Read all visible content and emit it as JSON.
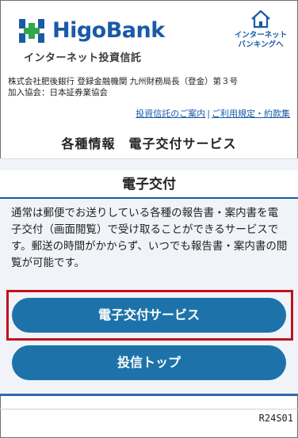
{
  "header": {
    "brand": "HigoBank",
    "subtitle": "インターネット投資信託",
    "internet_banking_line1": "インターネット",
    "internet_banking_line2": "バンキングへ"
  },
  "company": {
    "line1": "株式会社肥後銀行 登録金融機関 九州財務局長（登金）第３号",
    "line2": "加入協会：日本証券業協会"
  },
  "links": {
    "guide": "投資信託のご案内",
    "separator": "|",
    "terms": "ご利用規定・約款集"
  },
  "page_title": "各種情報　電子交付サービス",
  "section": {
    "heading": "電子交付",
    "description": "通常は郵便でお送りしている各種の報告書・案内書を電子交付（画面閲覧）で受け取ることができるサービスです。郵送の時間がかからず、いつでも報告書・案内書の閲覧が可能です。"
  },
  "buttons": {
    "e_delivery": "電子交付サービス",
    "investment_top": "投信トップ"
  },
  "footer": {
    "screen_id": "R24S01"
  },
  "colors": {
    "brand_blue": "#1a5aa7",
    "logo_green": "#32a84a",
    "button_blue": "#1d73a9",
    "highlight_red": "#c1121c"
  }
}
